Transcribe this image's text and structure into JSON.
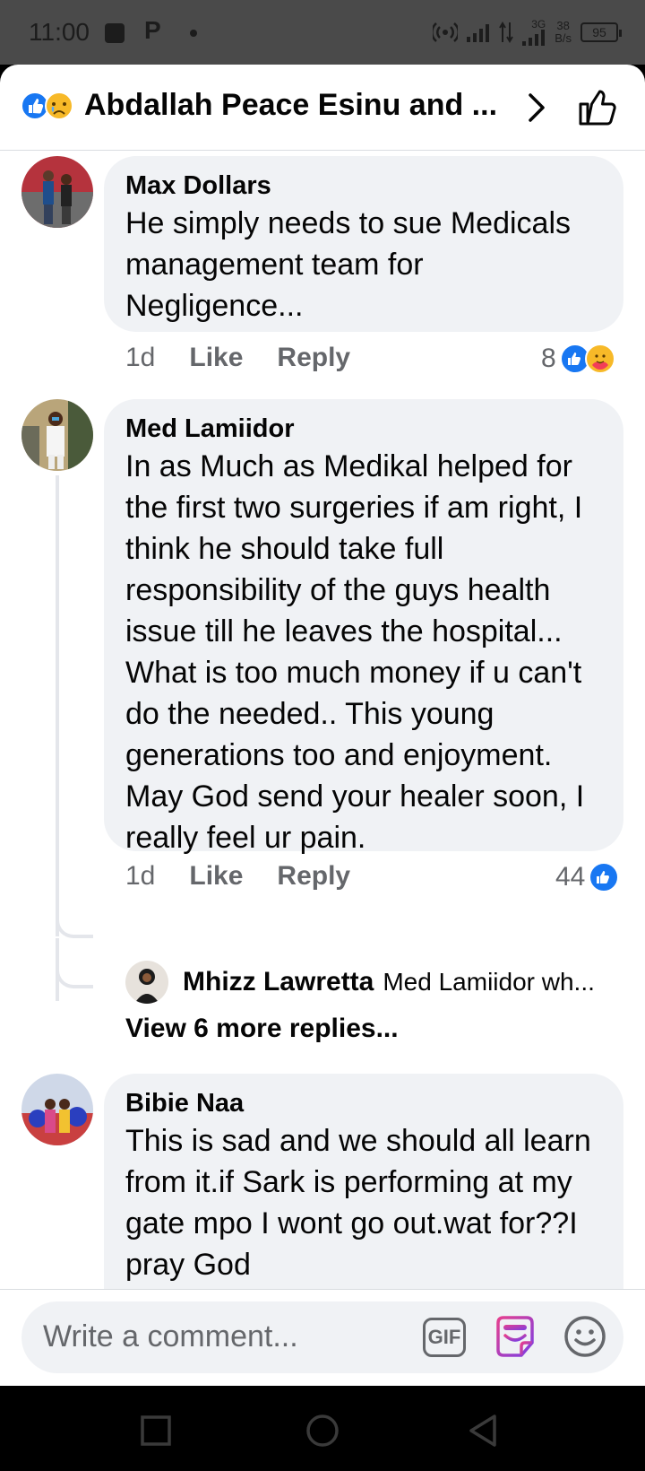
{
  "status_bar": {
    "time": "11:00",
    "p_letter": "P",
    "network": "3G",
    "speed_value": "38",
    "speed_unit": "B/s",
    "battery": "95"
  },
  "header": {
    "title": "Abdallah Peace Esinu and ..."
  },
  "comments": [
    {
      "author": "Max Dollars",
      "text": "He simply needs to sue Medicals management team for Negligence...",
      "time": "1d",
      "like_label": "Like",
      "reply_label": "Reply",
      "reaction_count": "8"
    },
    {
      "author": "Med Lamiidor",
      "text": "In as Much as Medikal helped for the first two surgeries if am right, I think he should take full responsibility of the guys health issue till he leaves the hospital... What is too much money if u can't do the needed.. This young generations too and enjoyment. May God send your healer soon, I really feel ur pain.",
      "time": "1d",
      "like_label": "Like",
      "reply_label": "Reply",
      "reaction_count": "44",
      "reply_preview": {
        "author": "Mhizz Lawretta",
        "text": "Med Lamiidor  wh..."
      },
      "view_more": "View 6 more replies..."
    },
    {
      "author": "Bibie Naa",
      "text": "This is sad and we should all learn from it.if Sark is performing at my gate mpo I wont go out.wat for??I pray God"
    }
  ],
  "composer": {
    "placeholder": "Write a comment...",
    "gif_label": "GIF"
  },
  "colors": {
    "like_blue": "#1877f2",
    "bubble_bg": "#f0f2f5",
    "secondary_text": "#65676b"
  }
}
